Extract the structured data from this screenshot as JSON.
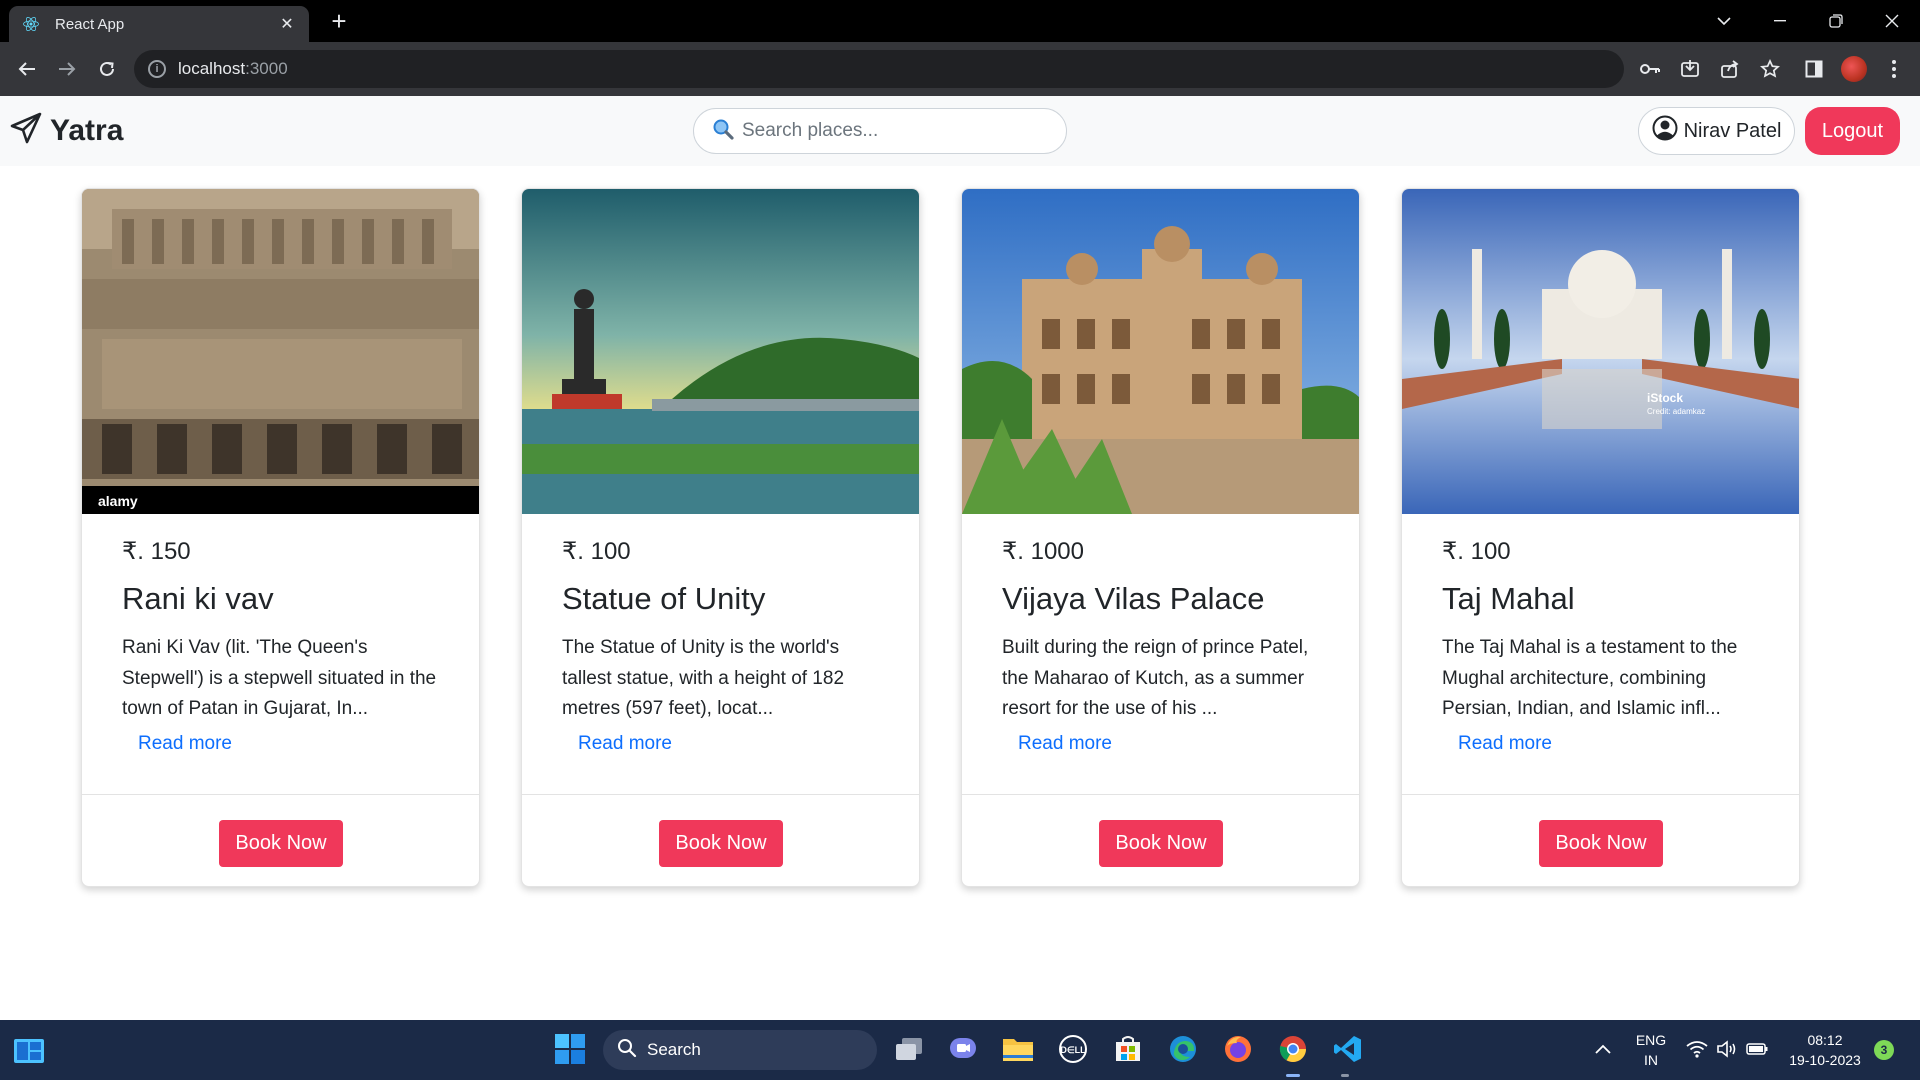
{
  "browser": {
    "tab_title": "React App",
    "url_host": "localhost",
    "url_port": ":3000"
  },
  "app": {
    "brand": "Yatra",
    "search_placeholder": "Search places...",
    "user_name": "Nirav Patel",
    "logout_label": "Logout"
  },
  "places": [
    {
      "price": "₹. 150",
      "name": "Rani ki vav",
      "description": "Rani Ki Vav (lit. 'The Queen's Stepwell') is a stepwell situated in the town of Patan in Gujarat, In...",
      "read_more": "Read more",
      "book_label": "Book Now"
    },
    {
      "price": "₹. 100",
      "name": "Statue of Unity",
      "description": "The Statue of Unity is the world's tallest statue, with a height of 182 metres (597 feet), locat...",
      "read_more": "Read more",
      "book_label": "Book Now"
    },
    {
      "price": "₹. 1000",
      "name": "Vijaya Vilas Palace",
      "description": "Built during the reign of prince Patel, the Maharao of Kutch, as a summer resort for the use of his ...",
      "read_more": "Read more",
      "book_label": "Book Now"
    },
    {
      "price": "₹. 100",
      "name": "Taj Mahal",
      "description": "The Taj Mahal is a testament to the Mughal architecture, combining Persian, Indian, and Islamic infl...",
      "read_more": "Read more",
      "book_label": "Book Now"
    }
  ],
  "image_watermarks": {
    "alamy": "alamy",
    "istock": "iStock",
    "istock_credit": "Credit: adamkaz"
  },
  "taskbar": {
    "search_label": "Search",
    "language": "ENG",
    "region": "IN",
    "time": "08:12",
    "date": "19-10-2023",
    "notification_count": "3"
  },
  "colors": {
    "accent": "#f0385a",
    "link": "#0d6efd",
    "navbar_bg": "#f8f9fa",
    "taskbar_bg": "#1b2a47"
  }
}
